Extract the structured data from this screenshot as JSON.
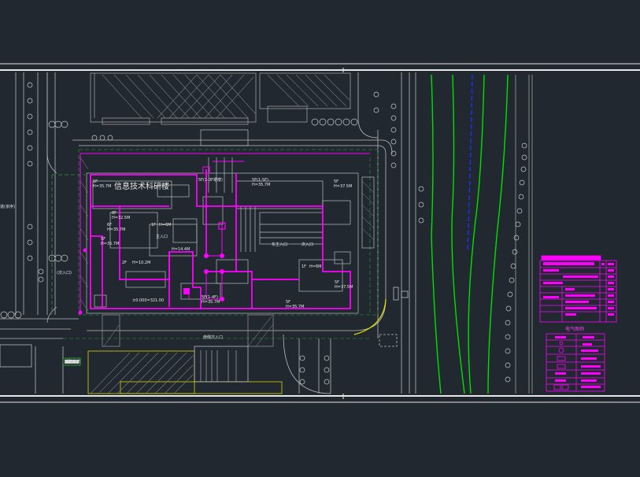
{
  "drawing": {
    "building_name": "信息技术科研楼",
    "left_edge_label": "道(京序)",
    "floor_labels": [
      {
        "key": "w1",
        "floors": "5F",
        "height": "H=35.7M"
      },
      {
        "key": "w2",
        "floors": "5F",
        "height": "H=35.7M"
      },
      {
        "key": "n1",
        "floors": "5F(1-3F裙楼)",
        "height": ""
      },
      {
        "key": "n2",
        "floors": "5F(1-5F)",
        "height": "H=35.7M"
      },
      {
        "key": "ne",
        "floors": "5F",
        "height": "H=37.5M"
      },
      {
        "key": "c1",
        "floors": "8F",
        "height": "H=32.5M"
      },
      {
        "key": "c2",
        "floors": "6F",
        "height": "H=35.7M"
      },
      {
        "key": "c3",
        "floors": "2F",
        "height": "H=10.2M"
      },
      {
        "key": "c4",
        "floors": "1F",
        "height": "H=6M"
      },
      {
        "key": "c5",
        "floors": "1F",
        "height": "H=6M"
      },
      {
        "key": "e1",
        "floors": "5F",
        "height": "H=37.5M"
      },
      {
        "key": "s1",
        "floors": "5F",
        "height": "H=35.7M"
      },
      {
        "key": "sw",
        "floors": "5F(1-4F)",
        "height": "H=35.7M"
      }
    ],
    "annotations": {
      "entrance_main": "主入口",
      "entrance_east": "东主入口",
      "entrance_ne": "次入口",
      "entrance_south": "南侧次入口",
      "entrance_west": "(次入口)",
      "elevation": "±0.000=321.00",
      "height_small": "H=14.4M",
      "green_tag": "消防车道"
    },
    "legend_title": "电气图例"
  },
  "colors": {
    "background": "#212830",
    "line": "#c8c8c8",
    "magenta": "#ff00ff",
    "green": "#00e000",
    "dark_green": "#2f7a3a",
    "blue": "#0000ff",
    "yellow": "#e0e000"
  }
}
